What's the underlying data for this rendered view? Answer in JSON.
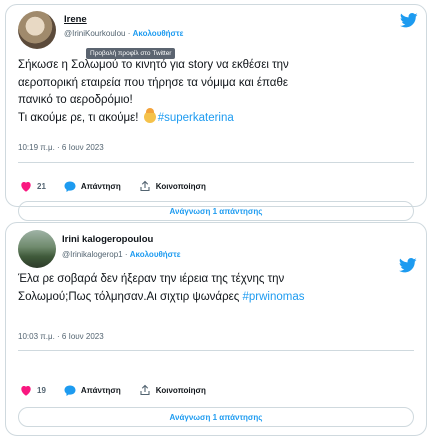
{
  "tweets": [
    {
      "name": "Irene",
      "handle": "@IriniKourkoulou",
      "separator": " · ",
      "follow_label": "Ακολουθήστε",
      "tooltip": "Προβολή προφίλ στο Twitter",
      "text_l1": "Σήκωσε η Σολωμού το κινητό για story  να εκθέσει την",
      "text_l2": "αεροπορική εταιρεία που τήρησε τα νόμιμα και έπαθε",
      "text_l3": "πανικό το αεροδρόμιο!",
      "text_l4": "Τι ακούμε ρε, τι ακούμε!",
      "hashtag": "#superkaterina",
      "timestamp": "10:19 π.μ. · 6 Ιουν 2023",
      "likes": "21",
      "reply_label": "Απάντηση",
      "share_label": "Κοινοποίηση",
      "read_replies": "Ανάγνωση 1 απάντησης"
    },
    {
      "name": "Irini kalogeropoulou",
      "handle": "@Irinikalogerop1",
      "separator": " · ",
      "follow_label": "Ακολουθήστε",
      "text_l1": "Έλα ρε σοβαρά δεν ήξεραν την ιέρεια της τέχνης την",
      "text_l2": "Σολωμού;Πως τόλμησαν.Αι σιχτιρ ψωνάρες",
      "hashtag": "#prwinomas",
      "timestamp": "10:03 π.μ. · 6 Ιουν 2023",
      "likes": "19",
      "reply_label": "Απάντηση",
      "share_label": "Κοινοποίηση",
      "read_replies": "Ανάγνωση 1 απάντησης"
    }
  ],
  "icons": [
    "avatar",
    "twitter-bird-icon",
    "heart-icon",
    "reply-icon",
    "share-icon",
    "emoji-icon"
  ],
  "colors": {
    "accent": "#1d9bf0",
    "heart": "#f91880",
    "text": "#0f1419",
    "muted": "#536471",
    "border": "#cfd9de"
  }
}
